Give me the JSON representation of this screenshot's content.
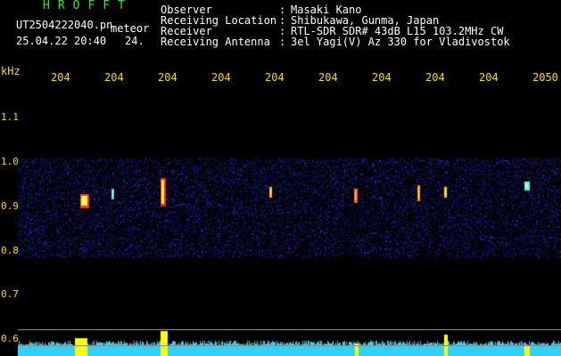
{
  "header": {
    "app_title": "HROFFT",
    "filename": "UT2504222040.pn",
    "meteor_label": "meteor",
    "date_time": "25.04.22 20:40",
    "count": "24.",
    "info": [
      {
        "key": "Observer",
        "value": "Masaki Kano"
      },
      {
        "key": "Receiving Location",
        "value": "Shibukawa, Gunma, Japan"
      },
      {
        "key": "Receiver",
        "value": "RTL-SDR SDR# 43dB L15 103.2MHz CW"
      },
      {
        "key": "Receiving Antenna",
        "value": "3el Yagi(V) Az 330 for Vladivostok"
      }
    ],
    "colon": ":"
  },
  "axis": {
    "unit": "kHz",
    "y_ticks": [
      "1.1",
      "1.0",
      "0.9",
      "0.8",
      "0.7",
      "0.6"
    ],
    "x_ticks": [
      "204",
      "204",
      "204",
      "204",
      "204",
      "204",
      "204",
      "204",
      "204",
      "2050"
    ]
  },
  "colors": {
    "background": "#000000",
    "noise_blue": "#1a2fd0",
    "signal_red": "#ff2020",
    "text_yellow": "#ffd800",
    "title_green": "#32e632",
    "bottom_cyan": "#2ad4ff",
    "bottom_yellow": "#ffff00"
  }
}
